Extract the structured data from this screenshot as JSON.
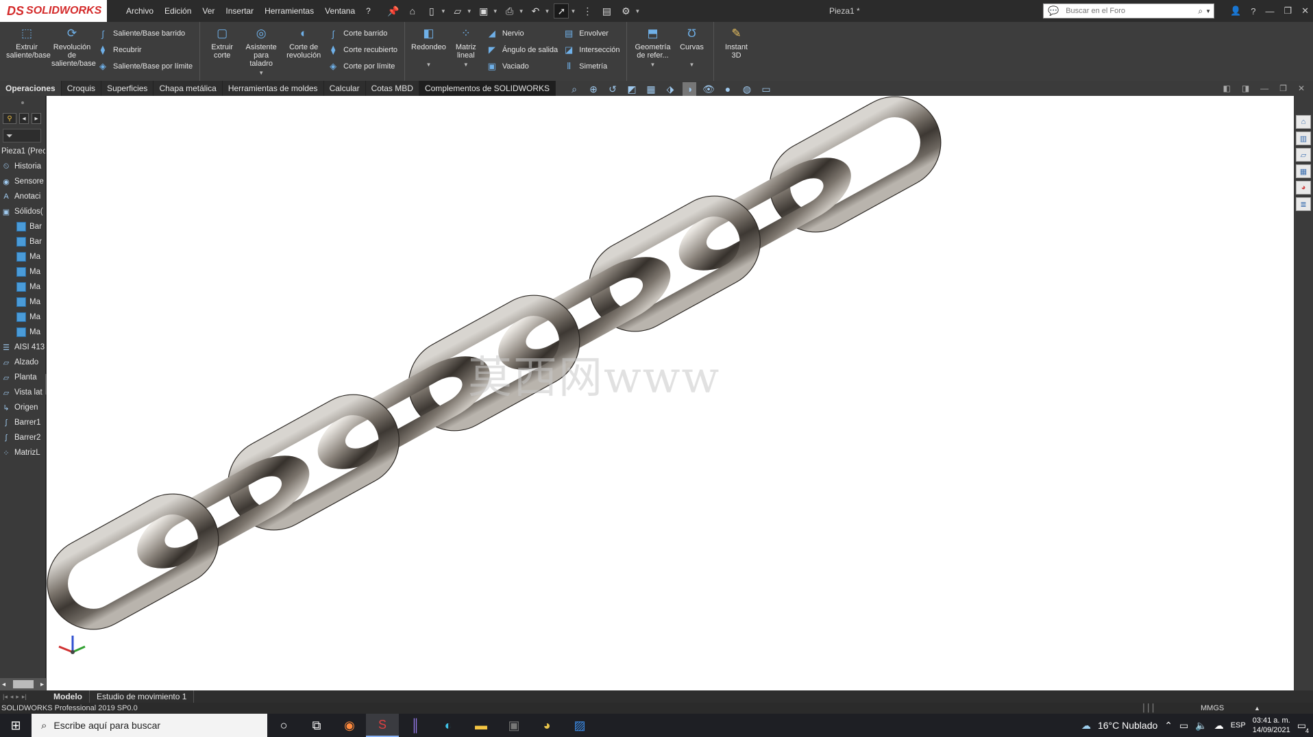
{
  "app": {
    "logo_prefix": "DS",
    "logo_name": "SOLIDWORKS",
    "doc_title": "Pieza1 *"
  },
  "menus": [
    "Archivo",
    "Edición",
    "Ver",
    "Insertar",
    "Herramientas",
    "Ventana",
    "?"
  ],
  "search": {
    "placeholder": "Buscar en el Foro"
  },
  "ribbon": {
    "extruir": "Extruir saliente/base",
    "revolucion": "Revolución de saliente/base",
    "saliente_barrido": "Saliente/Base barrido",
    "recubrir": "Recubrir",
    "saliente_limite": "Saliente/Base por límite",
    "extruir_corte": "Extruir corte",
    "asistente": "Asistente para taladro",
    "corte_revolucion": "Corte de revolución",
    "corte_barrido": "Corte barrido",
    "corte_recubierto": "Corte recubierto",
    "corte_limite": "Corte por límite",
    "redondeo": "Redondeo",
    "matriz": "Matriz lineal",
    "nervio": "Nervio",
    "angulo": "Ángulo de salida",
    "vaciado": "Vaciado",
    "envolver": "Envolver",
    "interseccion": "Intersección",
    "simetria": "Simetría",
    "geometria": "Geometría de refer...",
    "curvas": "Curvas",
    "instant": "Instant 3D"
  },
  "tabs": [
    "Operaciones",
    "Croquis",
    "Superficies",
    "Chapa metálica",
    "Herramientas de moldes",
    "Calcular",
    "Cotas MBD",
    "Complementos de SOLIDWORKS"
  ],
  "tree": {
    "root": "Pieza1 (Prec",
    "items": [
      {
        "label": "Historia",
        "icon": "history-icon"
      },
      {
        "label": "Sensore",
        "icon": "sensor-icon"
      },
      {
        "label": "Anotaci",
        "icon": "annotation-icon"
      },
      {
        "label": "Sólidos(",
        "icon": "solid-bodies-icon"
      }
    ],
    "bodies": [
      "Bar",
      "Bar",
      "Ma",
      "Ma",
      "Ma",
      "Ma",
      "Ma",
      "Ma"
    ],
    "items2": [
      {
        "label": "AISI 413",
        "icon": "material-icon"
      },
      {
        "label": "Alzado",
        "icon": "plane-icon"
      },
      {
        "label": "Planta",
        "icon": "plane-icon"
      },
      {
        "label": "Vista lat",
        "icon": "plane-icon"
      },
      {
        "label": "Origen",
        "icon": "origin-icon"
      },
      {
        "label": "Barrer1",
        "icon": "sweep-icon"
      },
      {
        "label": "Barrer2",
        "icon": "sweep-icon"
      },
      {
        "label": "MatrizL",
        "icon": "pattern-icon"
      }
    ]
  },
  "viewport": {
    "watermark": "莫西网www"
  },
  "bottom_tabs": [
    "Modelo",
    "Estudio de movimiento 1"
  ],
  "status": {
    "version": "SOLIDWORKS Professional 2019 SP0.0",
    "units": "MMGS"
  },
  "taskbar": {
    "search": "Escribe aquí para buscar",
    "weather": "16°C Nublado",
    "lang": "ESP",
    "time": "03:41 a. m.",
    "date": "14/09/2021",
    "notifications": "4"
  },
  "chain": {
    "links": 9
  }
}
